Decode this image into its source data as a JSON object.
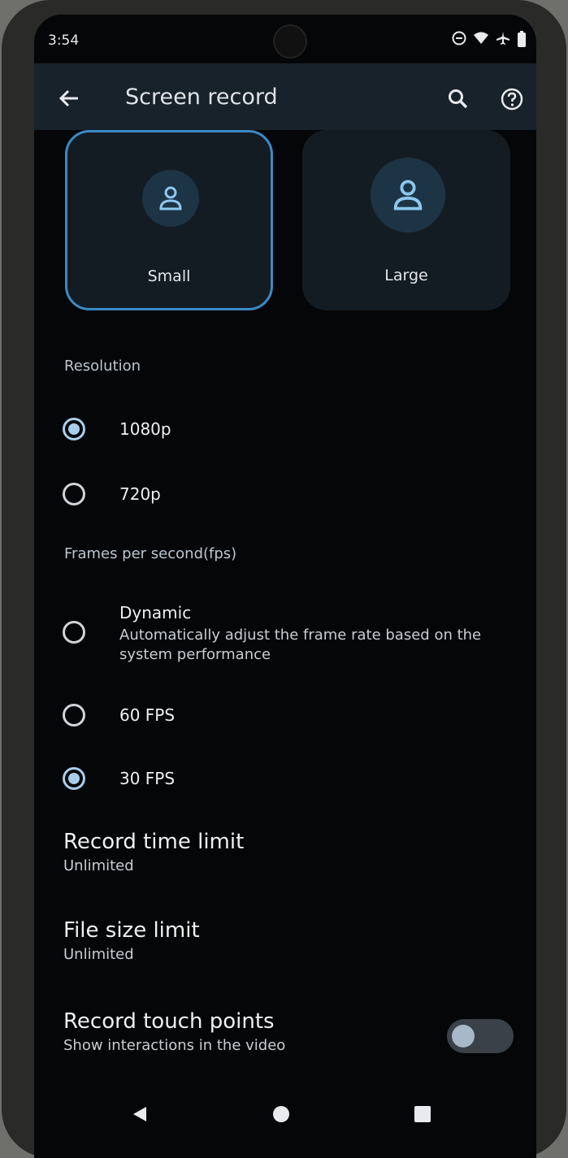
{
  "status": {
    "time": "3:54",
    "icons": [
      "dnd-icon",
      "wifi-icon",
      "airplane-icon",
      "battery-icon"
    ]
  },
  "appbar": {
    "title": "Screen record"
  },
  "size_cards": [
    {
      "label": "Small",
      "selected": true
    },
    {
      "label": "Large",
      "selected": false
    }
  ],
  "resolution": {
    "heading": "Resolution",
    "options": [
      {
        "label": "1080p",
        "selected": true
      },
      {
        "label": "720p",
        "selected": false
      }
    ]
  },
  "fps": {
    "heading": "Frames per second(fps)",
    "dynamic": {
      "label": "Dynamic",
      "description": "Automatically adjust the frame rate based on the system performance",
      "selected": false
    },
    "options": [
      {
        "label": "60 FPS",
        "selected": false
      },
      {
        "label": "30 FPS",
        "selected": true
      }
    ]
  },
  "record_time_limit": {
    "title": "Record time limit",
    "value": "Unlimited"
  },
  "file_size_limit": {
    "title": "File size limit",
    "value": "Unlimited"
  },
  "touch_points": {
    "title": "Record touch points",
    "subtitle": "Show interactions in the video",
    "enabled": false
  },
  "colors": {
    "accent": "#a8cdea",
    "background": "#050607",
    "appbar": "#18222b",
    "card": "#141c23"
  }
}
